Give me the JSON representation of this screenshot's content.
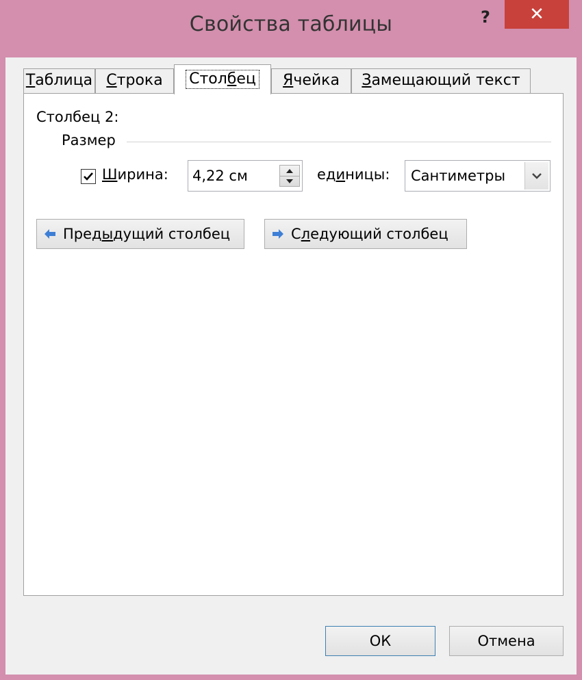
{
  "window": {
    "title": "Свойства таблицы",
    "help": "?",
    "close": "✕",
    "frame_color": "#d38fad",
    "close_color": "#c8413b"
  },
  "tabs": [
    {
      "pre": "",
      "u": "Т",
      "post": "аблица",
      "active": false
    },
    {
      "pre": "",
      "u": "С",
      "post": "трока",
      "active": false
    },
    {
      "pre": "Стол",
      "u": "б",
      "post": "ец",
      "active": true
    },
    {
      "pre": "",
      "u": "Я",
      "post": "чейка",
      "active": false
    },
    {
      "pre": "",
      "u": "З",
      "post": "амещающий текст",
      "active": false
    }
  ],
  "column": {
    "heading": "Столбец 2:",
    "group": "Размер",
    "width_checkbox_checked": true,
    "width_label": {
      "u": "Ш",
      "post": "ирина:"
    },
    "width_value": "4,22 см",
    "units_label": {
      "pre": "ед",
      "u": "и",
      "post": "ницы:"
    },
    "units_value": "Сантиметры"
  },
  "nav": {
    "prev": {
      "pre": "Пред",
      "u": "ы",
      "post": "дущий столбец"
    },
    "next": {
      "pre": "С",
      "u": "л",
      "post": "едующий столбец"
    },
    "arrow_color": "#3d7fd6"
  },
  "footer": {
    "ok": "ОК",
    "cancel": "Отмена"
  }
}
